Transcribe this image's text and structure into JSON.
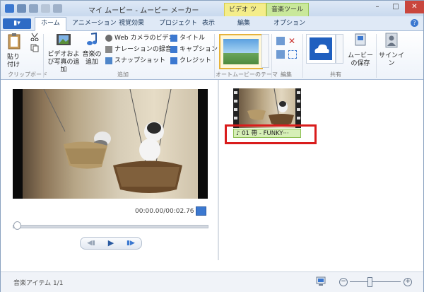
{
  "title_bar": {
    "app_title": "マイ ムービー - ムービー メーカー",
    "contextual_tabs": [
      "ビデオ ツール",
      "音楽ツール"
    ]
  },
  "tabs": {
    "file_label": "▮▾",
    "items": [
      "ホーム",
      "アニメーション",
      "視覚効果",
      "プロジェクト",
      "表示",
      "編集",
      "オプション"
    ]
  },
  "ribbon": {
    "clipboard": {
      "paste_label": "貼り付け",
      "group_label": "クリップボード"
    },
    "add": {
      "add_video_photo_label": "ビデオおよび写真の追加",
      "add_music_label": "音楽の追加",
      "webcam_label": "Web カメラのビデオ",
      "narration_label": "ナレーションの録音",
      "snapshot_label": "スナップショット",
      "title_label": "タイトル",
      "caption_label": "キャプション",
      "credit_label": "クレジット",
      "group_label": "追加"
    },
    "automovie": {
      "group_label": "オートムービーのテーマ"
    },
    "edit": {
      "group_label": "編集"
    },
    "share": {
      "save_movie_label": "ムービーの保存",
      "sign_in_label": "サインイン",
      "group_label": "共有"
    }
  },
  "preview": {
    "timecode": "00:00.00/00:02.76",
    "playback_progress": 0
  },
  "storyboard": {
    "music_item_label": "♪ 01 帶 - FUNKY···"
  },
  "status": {
    "text": "音楽アイテム 1/1",
    "zoom_level": 0.35
  },
  "colors": {
    "title_gradient": "#dfe9f6",
    "accent_blue": "#3b78d0",
    "video_tools_tab": "#f4ed8a",
    "music_tools_tab": "#c9e89b",
    "highlight_red": "#d91c1c"
  }
}
